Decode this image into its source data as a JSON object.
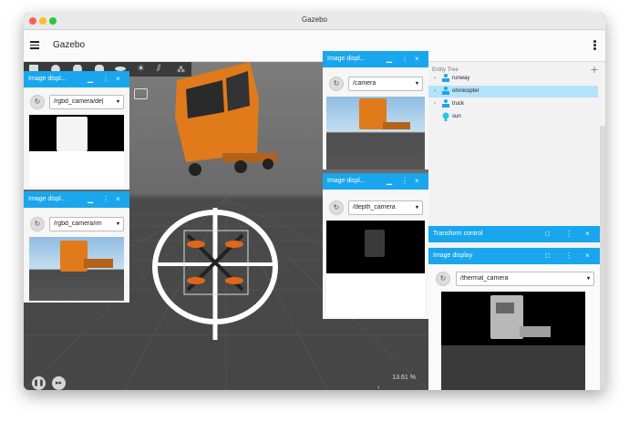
{
  "window": {
    "title": "Gazebo"
  },
  "appbar": {
    "title": "Gazebo"
  },
  "scene": {
    "zoom": "13.61 %"
  },
  "panels": {
    "left_top": {
      "title": "Image displ...",
      "topic": "/rgbd_camera/de|"
    },
    "left_bottom": {
      "title": "Image displ...",
      "topic": "/rgbd_camera/im"
    },
    "right_top": {
      "title": "Image displ...",
      "topic": "/camera"
    },
    "right_bottom": {
      "title": "Image displ...",
      "topic": "/depth_camera"
    }
  },
  "sidebar": {
    "entity_tree_title": "Entity Tree",
    "entities": [
      {
        "label": "runway",
        "icon": "model-icon",
        "selected": false
      },
      {
        "label": "omnicopter",
        "icon": "model-icon",
        "selected": true
      },
      {
        "label": "truck",
        "icon": "model-icon",
        "selected": false
      },
      {
        "label": "sun",
        "icon": "light-icon",
        "selected": false
      }
    ],
    "transform_control": "Transform control",
    "image_display": "Image display",
    "image_display_topic": "/thermal_camera"
  },
  "colors": {
    "accent": "#19a6ec",
    "selected_row": "#b5e2fb",
    "truck_orange": "#e07a1a"
  }
}
